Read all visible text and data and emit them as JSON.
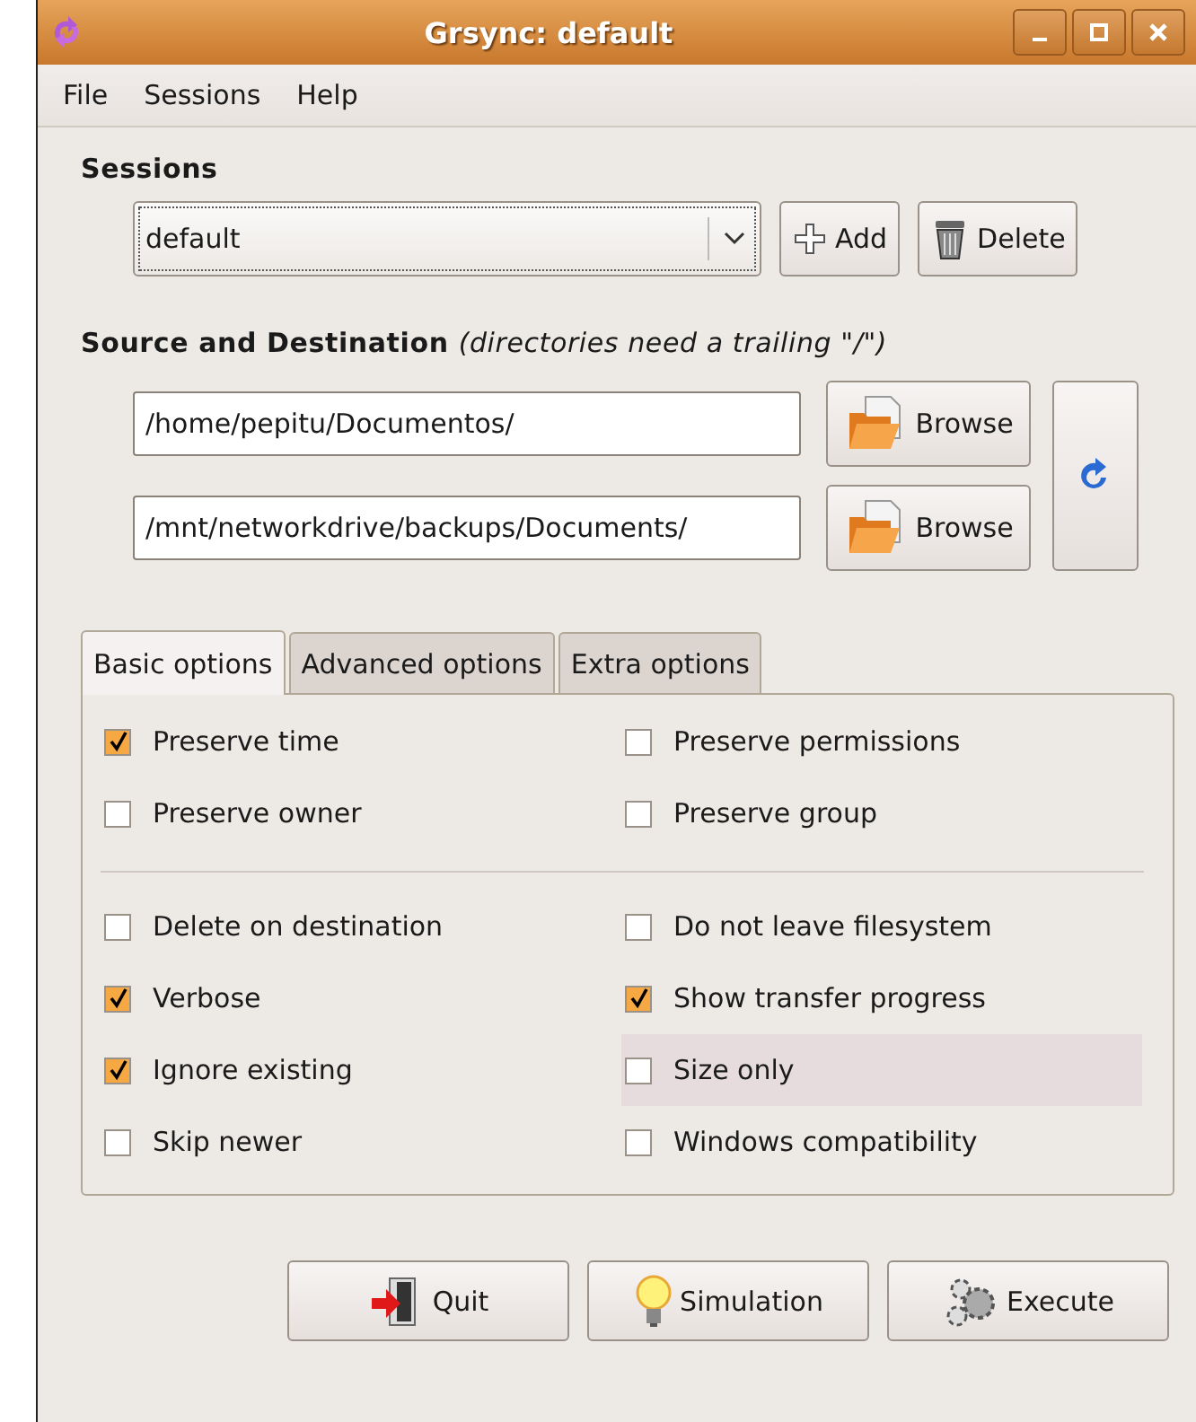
{
  "window": {
    "title": "Grsync: default"
  },
  "menu": [
    {
      "label": "File"
    },
    {
      "label": "Sessions"
    },
    {
      "label": "Help"
    }
  ],
  "sessions": {
    "heading": "Sessions",
    "value": "default",
    "buttons": [
      {
        "label": "Add",
        "kind": "add"
      },
      {
        "label": "Delete",
        "kind": "delete"
      }
    ]
  },
  "source_destination": {
    "heading": "Source and Destination",
    "note": "(directories need a trailing \"/\")",
    "paths": [
      {
        "value": "/home/pepitu/Documentos/",
        "button": "Browse"
      },
      {
        "value": "/mnt/networkdrive/backups/Documents/",
        "button": "Browse"
      }
    ]
  },
  "tabs": [
    {
      "label": "Basic options",
      "selected": true
    },
    {
      "label": "Advanced options",
      "selected": false
    },
    {
      "label": "Extra options",
      "selected": false
    }
  ],
  "option_groups": [
    {
      "items": [
        {
          "label": "Preserve time",
          "checked": true,
          "hovered": false
        },
        {
          "label": "Preserve permissions",
          "checked": false,
          "hovered": false
        },
        {
          "label": "Preserve owner",
          "checked": false,
          "hovered": false
        },
        {
          "label": "Preserve group",
          "checked": false,
          "hovered": false
        }
      ]
    },
    {
      "items": [
        {
          "label": "Delete on destination",
          "checked": false,
          "hovered": false
        },
        {
          "label": "Do not leave filesystem",
          "checked": false,
          "hovered": false
        },
        {
          "label": "Verbose",
          "checked": true,
          "hovered": false
        },
        {
          "label": "Show transfer progress",
          "checked": true,
          "hovered": false
        },
        {
          "label": "Ignore existing",
          "checked": true,
          "hovered": false
        },
        {
          "label": "Size only",
          "checked": false,
          "hovered": true
        },
        {
          "label": "Skip newer",
          "checked": false,
          "hovered": false
        },
        {
          "label": "Windows compatibility",
          "checked": false,
          "hovered": false
        }
      ]
    }
  ],
  "actions": [
    {
      "label": "Quit",
      "kind": "quit"
    },
    {
      "label": "Simulation",
      "kind": "simulation"
    },
    {
      "label": "Execute",
      "kind": "execute"
    }
  ]
}
